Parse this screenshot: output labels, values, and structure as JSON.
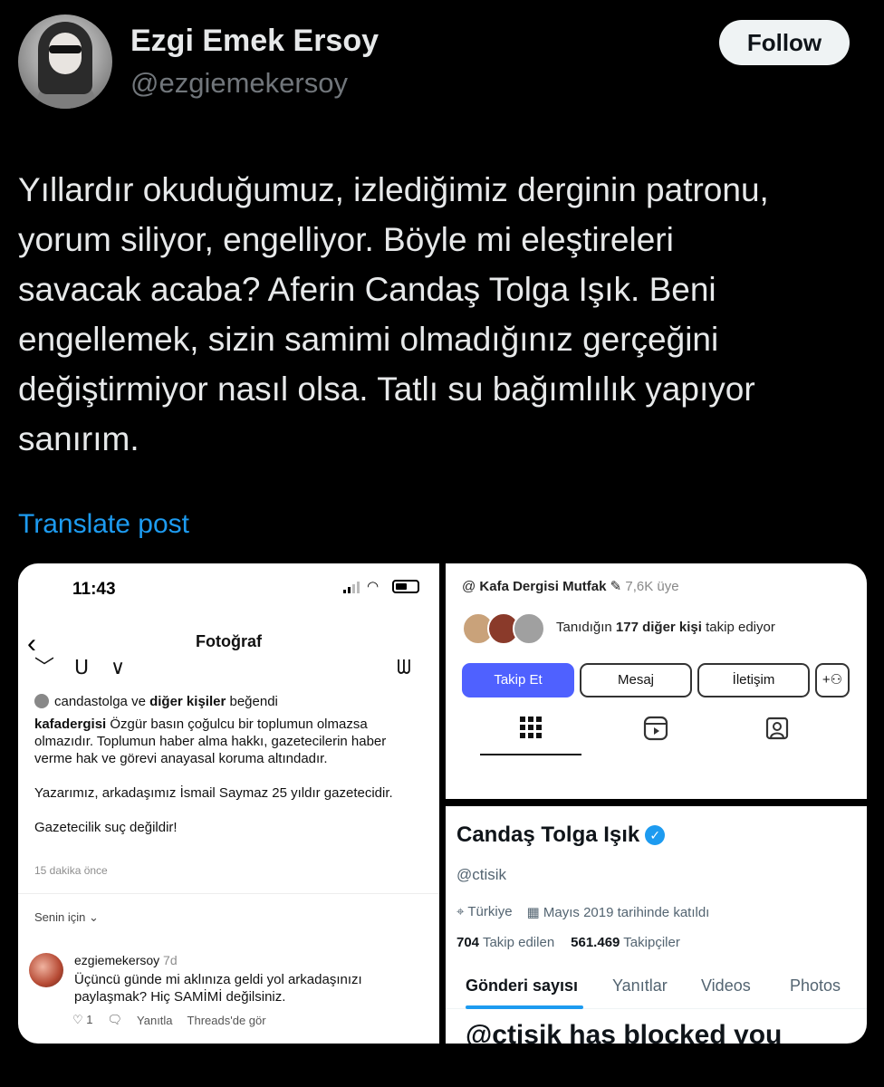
{
  "tweet": {
    "author_name": "Ezgi Emek Ersoy",
    "author_handle": "@ezgiemekersoy",
    "follow_label": "Follow",
    "text_lines": [
      "Yıllardır okuduğumuz, izlediğimiz derginin patronu,",
      "yorum siliyor, engelliyor. Böyle mi eleştireleri",
      "savacak acaba? Aferin Candaş Tolga Işık. Beni",
      "engellemek, sizin samimi olmadığınız gerçeğini",
      "değiştirmiyor nasıl olsa. Tatlı su bağımlılık yapıyor",
      "sanırım."
    ],
    "translate_label": "Translate post"
  },
  "instagram": {
    "time": "11:43",
    "title": "Fotoğraf",
    "liked_user": "candastolga",
    "liked_mid": " ve ",
    "liked_others": "diğer kişiler",
    "liked_suffix": " beğendi",
    "caption_user": "kafadergisi",
    "caption_p1": " Özgür basın çoğulcu bir toplumun olmazsa olmazıdır. Toplumun haber alma hakkı, gazetecilerin haber verme hak ve görevi anayasal koruma altındadır.",
    "caption_p2": "Yazarımız, arkadaşımız İsmail Saymaz 25 yıldır gazetecidir.",
    "caption_p3": "Gazetecilik suç değildir!",
    "posted_ago": "15 dakika önce",
    "sort_label": "Senin için",
    "comment": {
      "user": "ezgiemekersoy",
      "ago": "7d",
      "text": "Üçüncü günde mi aklınıza geldi yol arkadaşınızı paylaşmak? Hiç SAMİMİ değilsiniz.",
      "like_count": "1",
      "reply_label": "Yanıtla",
      "threads_label": "Threads'de gör"
    }
  },
  "kafa_profile": {
    "community_name": "Kafa Dergisi Mutfak",
    "member_count": "7,6K üye",
    "known_prefix": "Tanıdığın ",
    "known_bold": "177 diğer kişi",
    "known_suffix": " takip ediyor",
    "follow_button": "Takip Et",
    "message_button": "Mesaj",
    "contact_button": "İletişim",
    "accent_color": "#4f61ff"
  },
  "twitter_profile": {
    "name": "Candaş Tolga Işık",
    "handle": "@ctisik",
    "location": "Türkiye",
    "joined": "Mayıs 2019 tarihinde katıldı",
    "following_count": "704",
    "following_label": "Takip edilen",
    "followers_count": "561.469",
    "followers_label": "Takipçiler",
    "tabs": [
      "Gönderi sayısı",
      "Yanıtlar",
      "Videos",
      "Photos"
    ],
    "blocked_text": "@ctisik has blocked you",
    "accent_color": "#1d9bf0"
  }
}
